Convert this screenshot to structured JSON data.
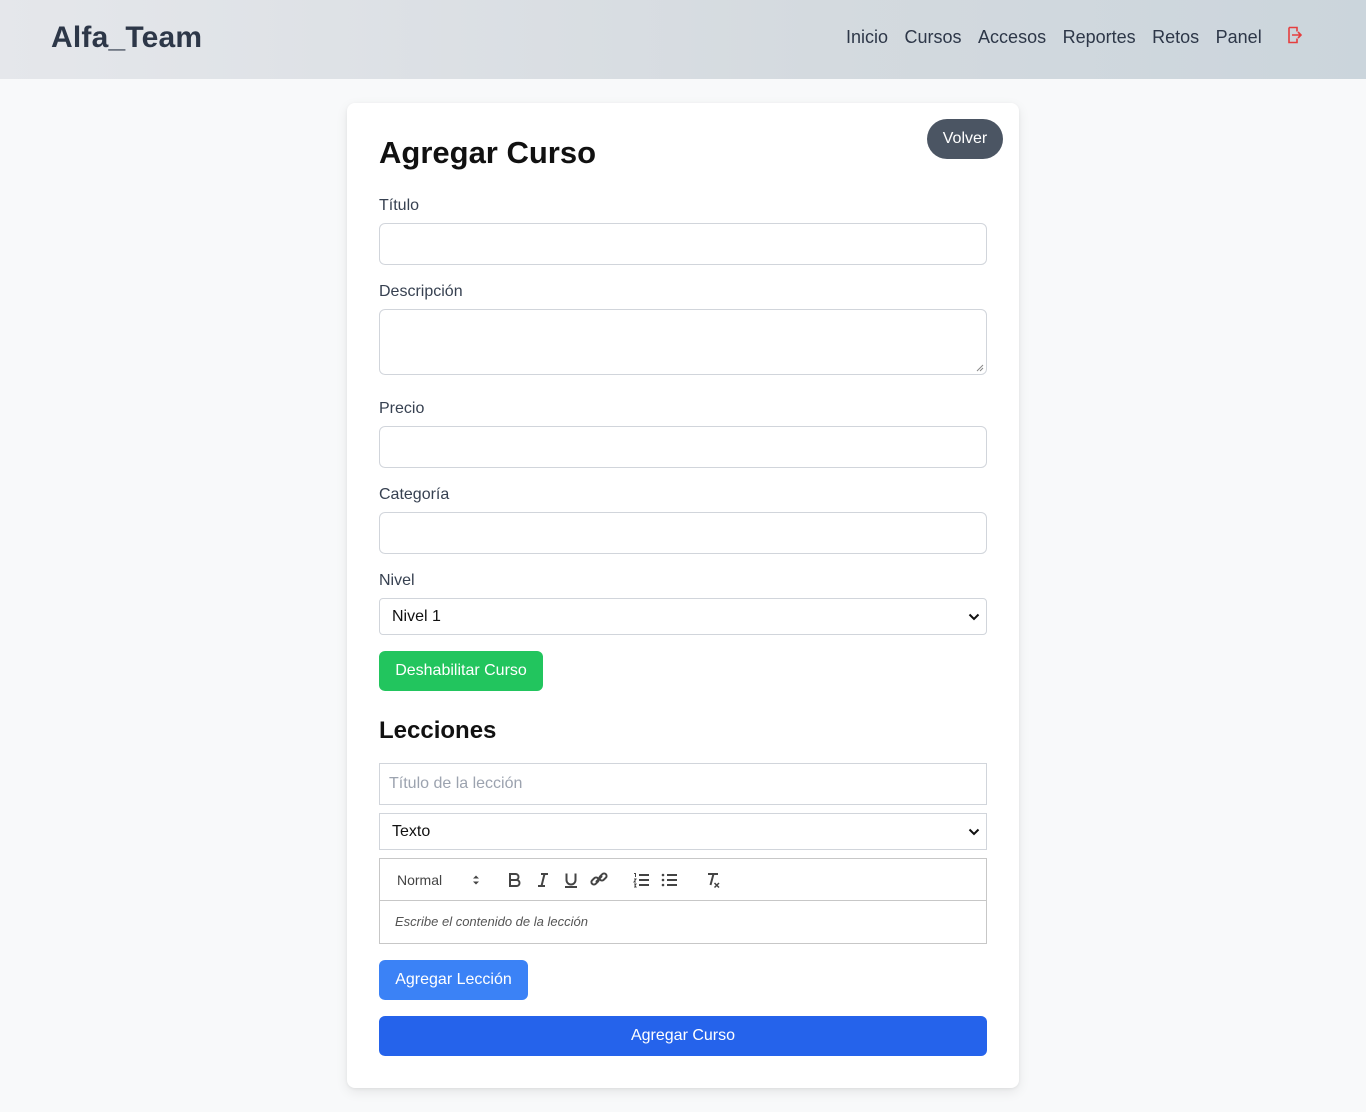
{
  "brand": "Alfa_Team",
  "nav": {
    "links": [
      "Inicio",
      "Cursos",
      "Accesos",
      "Reportes",
      "Retos",
      "Panel"
    ],
    "logout_icon": "logout-icon",
    "logout_color": "#e53e3e"
  },
  "form": {
    "back_label": "Volver",
    "title": "Agregar Curso",
    "fields": {
      "titulo_label": "Título",
      "titulo_value": "",
      "descripcion_label": "Descripción",
      "descripcion_value": "",
      "precio_label": "Precio",
      "precio_value": "",
      "categoria_label": "Categoría",
      "categoria_value": "",
      "nivel_label": "Nivel",
      "nivel_selected": "Nivel 1"
    },
    "disable_label": "Deshabilitar Curso",
    "lessons": {
      "heading": "Lecciones",
      "title_placeholder": "Título de la lección",
      "type_selected": "Texto",
      "editor": {
        "header_selected": "Normal",
        "tools": [
          "bold-icon",
          "italic-icon",
          "underline-icon",
          "link-icon",
          "ordered-list-icon",
          "bullet-list-icon",
          "clear-format-icon"
        ],
        "placeholder": "Escribe el contenido de la lección"
      },
      "add_label": "Agregar Lección"
    },
    "submit_label": "Agregar Curso"
  },
  "colors": {
    "green": "#22c55e",
    "blue": "#3b82f6",
    "primary": "#2563eb",
    "back_button": "#4b5563"
  }
}
